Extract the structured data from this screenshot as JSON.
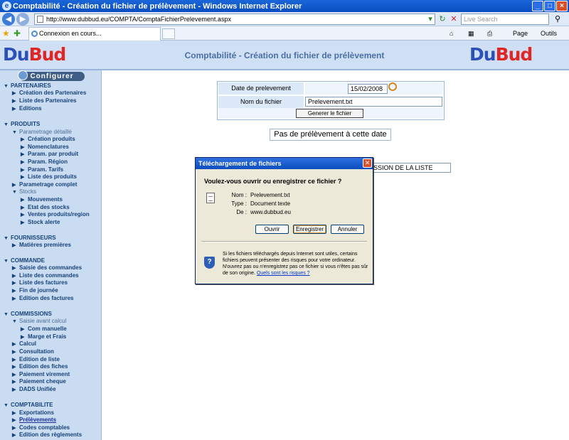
{
  "browser": {
    "window_title": "Comptabilité - Création du fichier de prélèvement - Windows Internet Explorer",
    "url": "http://www.dubbud.eu/COMPTA/ComptaFichierPrelevement.aspx",
    "search_placeholder": "Live Search",
    "tab_label": "Connexion en cours...",
    "cmd_page": "Page",
    "cmd_tools": "Outils"
  },
  "banner": {
    "logo_left_a": "Du",
    "logo_left_b": "Bud",
    "logo_right_a": "Du",
    "logo_right_b": "Bud",
    "title": "Comptabilité - Création du fichier de prélèvement"
  },
  "sidebar": {
    "configure": "Configurer",
    "s1": "PARTENAIRES",
    "s1_1": "Création des Partenaires",
    "s1_2": "Liste des Partenaires",
    "s1_3": "Editions",
    "s2": "PRODUITS",
    "s2_1": "Parametrage détaillé",
    "s2_1a": "Création produits",
    "s2_1b": "Nomenclatures",
    "s2_1c": "Param. par produit",
    "s2_1d": "Param. Région",
    "s2_1e": "Param. Tarifs",
    "s2_1f": "Liste des produits",
    "s2_2": "Parametrage complet",
    "s2_3": "Stocks",
    "s2_3a": "Mouvements",
    "s2_3b": "Etat des stocks",
    "s2_3c": "Ventes produits/region",
    "s2_3d": "Stock alerte",
    "s3": "FOURNISSEURS",
    "s3_1": "Matières premières",
    "s4": "COMMANDE",
    "s4_1": "Saisie des commandes",
    "s4_2": "Liste des commandes",
    "s4_3": "Liste des factures",
    "s4_4": "Fin de journée",
    "s4_5": "Edition des factures",
    "s5": "COMMISSIONS",
    "s5_1": "Saisie avant calcul",
    "s5_1a": "Com manuelle",
    "s5_1b": "Marge et Frais",
    "s5_2": "Calcul",
    "s5_3": "Consultation",
    "s5_4": "Edition de liste",
    "s5_5": "Edition des fiches",
    "s5_6": "Paiement virement",
    "s5_7": "Paiement cheque",
    "s5_8": "DADS Unifiée",
    "s6": "COMPTABILITE",
    "s6_1": "Exportations",
    "s6_2": "Prélèvements",
    "s6_3": "Codes comptables",
    "s6_4": "Edition des règlements"
  },
  "form": {
    "date_label": "Date de prelevement",
    "date_value": "15/02/2008",
    "file_label": "Nom du fichier",
    "file_value": "Prelevement.txt",
    "generate": "Generer le fichier",
    "no_result": "Pas de prélèvement à cette date",
    "print_partial": "SSION DE LA LISTE"
  },
  "dialog": {
    "title": "Téléchargement de fichiers",
    "question": "Voulez-vous ouvrir ou enregistrer ce fichier ?",
    "name_key": "Nom :",
    "name_val": "Prelevement.txt",
    "type_key": "Type :",
    "type_val": "Document texte",
    "from_key": "De :",
    "from_val": "www.dubbud.eu",
    "open": "Ouvrir",
    "save": "Enregistrer",
    "cancel": "Annuler",
    "warning": "Si les fichiers téléchargés depuis Internet sont utiles, certains fichiers peuvent présenter des risques pour votre ordinateur. N'ouvrez pas ou n'enregistrez pas ce fichier si vous n'êtes pas sûr de son origine.",
    "risks_link": "Quels sont les risques ?"
  }
}
